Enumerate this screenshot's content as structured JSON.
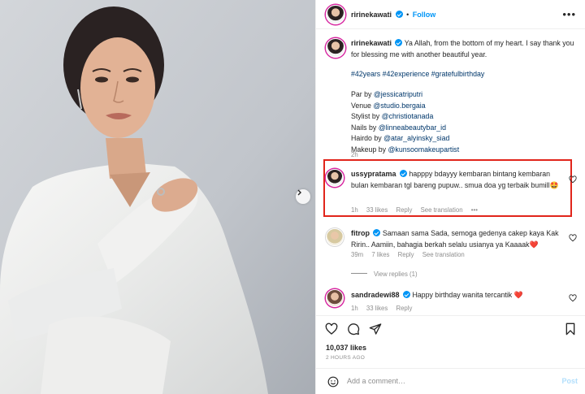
{
  "post": {
    "author": "ririnekawati",
    "follow_label": "Follow",
    "more_icon": "•••",
    "caption_main": "Ya Allah, from the bottom of my heart. I say thank you for blessing me with another beautiful year.",
    "hashtags": "#42years #42experience #gratefulbirthday",
    "credits": [
      {
        "label": "Par by ",
        "handle": "@jessicatriputri"
      },
      {
        "label": "Venue ",
        "handle": "@studio.bergaia"
      },
      {
        "label": "Stylist by ",
        "handle": "@christiotanada"
      },
      {
        "label": "Nails by ",
        "handle": "@linneabeautybar_id"
      },
      {
        "label": "Hairdo by ",
        "handle": "@atar_alyinsky_siad"
      },
      {
        "label": "Makeup by ",
        "handle": "@kunsoomakeupartist"
      }
    ],
    "caption_time": "2h"
  },
  "comments": [
    {
      "user": "ussypratama",
      "text": "happpy bdayyy kembaran bintang kembaran bulan kembaran tgl bareng pupuw.. smua doa yg terbaik bumill",
      "emoji": "🤩",
      "time": "1h",
      "likes": "33 likes",
      "reply": "Reply",
      "translation": "See translation",
      "more": "•••"
    },
    {
      "user": "fitrop",
      "text": "Samaan sama Sada, semoga gedenya cakep kaya Kak Ririn.. Aamiin, bahagia berkah selalu usianya ya Kaaaak",
      "emoji": "❤️",
      "time": "39m",
      "likes": "7 likes",
      "reply": "Reply",
      "translation": "See translation",
      "view_replies": "View replies (1)"
    },
    {
      "user": "sandradewi88",
      "text": "Happy birthday wanita tercantik",
      "emoji": "❤️",
      "time": "1h",
      "likes": "33 likes",
      "reply": "Reply"
    }
  ],
  "stats": {
    "likes": "10,037 likes",
    "time_ago": "2 HOURS AGO"
  },
  "composer": {
    "placeholder": "Add a comment…",
    "post_label": "Post"
  },
  "icons": {
    "like": "heart-icon",
    "comment": "comment-icon",
    "share": "share-icon",
    "save": "bookmark-icon",
    "emoji": "emoji-icon",
    "next": "chevron-right-icon"
  },
  "colors": {
    "accent": "#0095f6",
    "highlight": "#e1251b",
    "heart": "#ed4956",
    "link": "#00376b"
  }
}
